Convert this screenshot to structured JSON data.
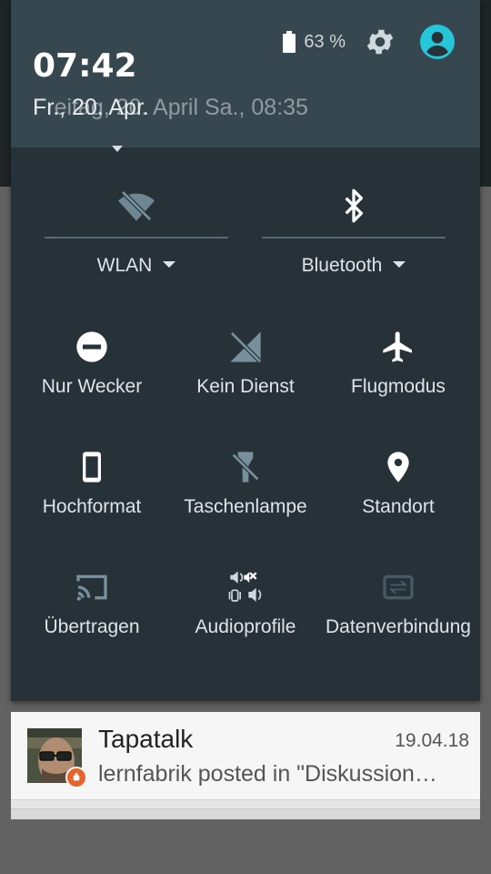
{
  "status": {
    "battery_percent": "63 %",
    "icons": [
      "battery-icon",
      "settings-gear-icon",
      "user-avatar-icon"
    ]
  },
  "header": {
    "time": "07:42",
    "date_primary": "Fr., 20. Apr.",
    "date_overlay": "Freitag, 20. April Sa., 08:35"
  },
  "big_tiles": [
    {
      "label": "WLAN",
      "icon": "wifi-off-icon"
    },
    {
      "label": "Bluetooth",
      "icon": "bluetooth-icon"
    }
  ],
  "tiles": [
    {
      "label": "Nur Wecker",
      "icon": "do-not-disturb-icon"
    },
    {
      "label": "Kein Dienst",
      "icon": "no-signal-icon"
    },
    {
      "label": "Flugmodus",
      "icon": "airplane-icon"
    },
    {
      "label": "Hochformat",
      "icon": "portrait-phone-icon"
    },
    {
      "label": "Taschenlampe",
      "icon": "flashlight-off-icon"
    },
    {
      "label": "Standort",
      "icon": "location-pin-icon"
    },
    {
      "label": "Übertragen",
      "icon": "cast-icon"
    },
    {
      "label": "Audioprofile",
      "icon": "audio-profiles-icon"
    },
    {
      "label": "Datenverbindung",
      "icon": "data-connection-icon"
    }
  ],
  "notification": {
    "app": "Tapatalk",
    "date": "19.04.18",
    "body": "lernfabrik posted in \"Diskussion…",
    "icons": [
      "avatar",
      "tapatalk-badge-icon"
    ]
  },
  "colors": {
    "panel": "#263238",
    "header": "#37474f",
    "accent": "#26c6da",
    "icon_active": "#ffffff",
    "icon_inactive": "#78909c"
  }
}
